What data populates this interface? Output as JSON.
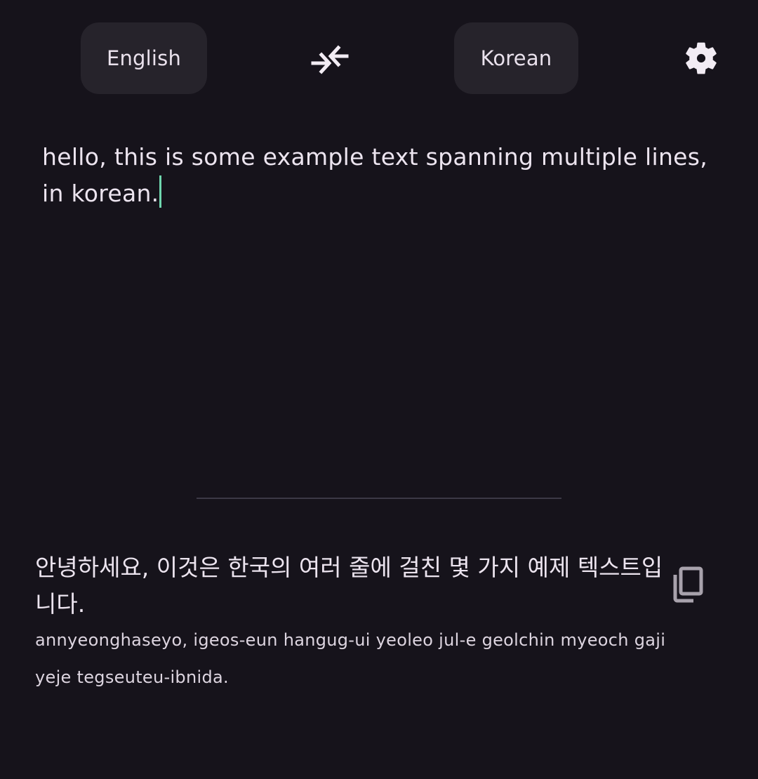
{
  "languages": {
    "source": "English",
    "target": "Korean"
  },
  "icons": {
    "swap": "swap-arrows-icon",
    "settings": "gear-icon",
    "copy": "copy-icon"
  },
  "input": {
    "text": "hello, this is some example text spanning multiple lines, in korean."
  },
  "output": {
    "translation": "안녕하세요, 이것은 한국의 여러 줄에 걸친 몇 가지 예제 텍스트입니다.",
    "romanization": "annyeonghaseyo, igeos-eun hangug-ui yeoleo jul-e geolchin myeoch gaji yeje tegseuteu-ibnida."
  },
  "colors": {
    "background": "#16131b",
    "button": "#26232b",
    "caret": "#6fd6ae"
  }
}
